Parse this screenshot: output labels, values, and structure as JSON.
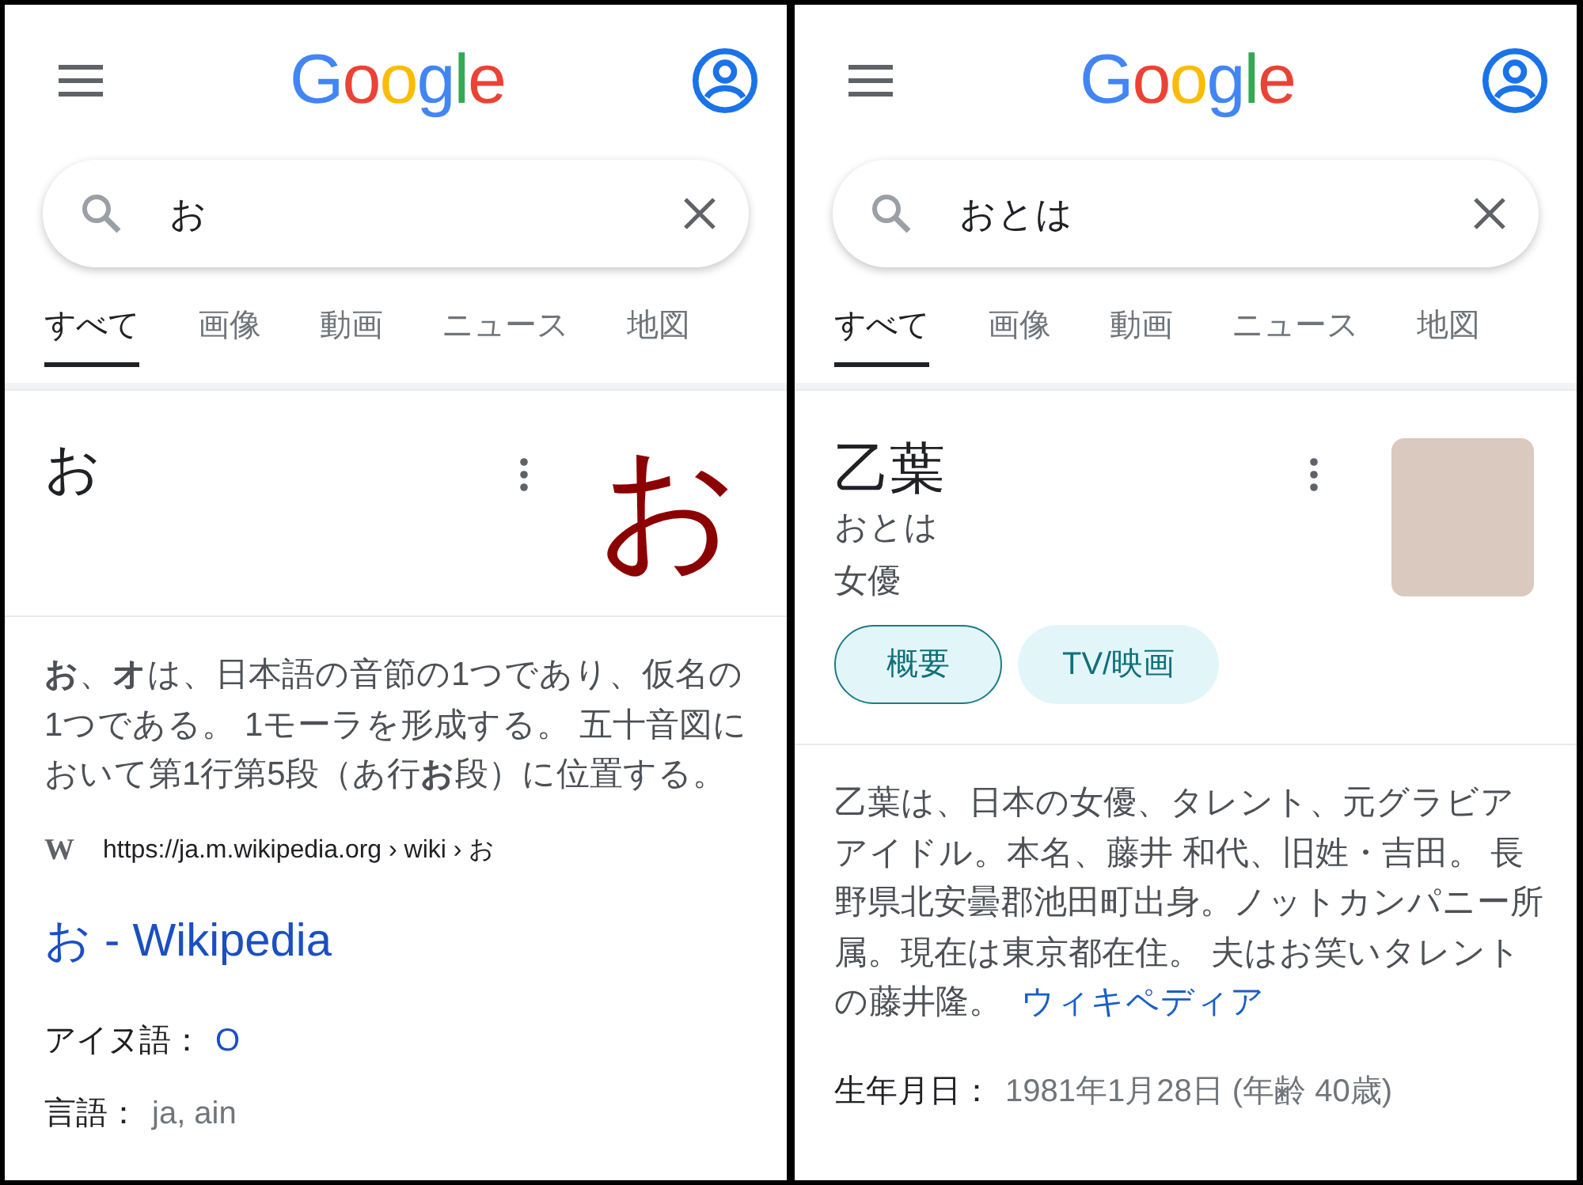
{
  "panels": [
    {
      "logo": "Google",
      "search": {
        "value": "お"
      },
      "tabs": [
        {
          "label": "すべて",
          "selected": true
        },
        {
          "label": "画像",
          "selected": false
        },
        {
          "label": "動画",
          "selected": false
        },
        {
          "label": "ニュース",
          "selected": false
        },
        {
          "label": "地図",
          "selected": false
        }
      ],
      "card": {
        "kind": "character",
        "title": "お",
        "glyph": "お",
        "description": "**お**、**オ**は、日本語の音節の1つであり、仮名の1つである。 1モーラを形成する。 五十音図において第1行第5段（あ行**お**段）に位置する。",
        "source": {
          "favicon": "W",
          "url": "https://ja.m.wikipedia.org › wiki › お"
        },
        "link_title": "お - Wikipedia",
        "facts": [
          {
            "label": "アイヌ語：",
            "value": "O",
            "link": true
          },
          {
            "label": "言語：",
            "value": "ja, ain",
            "link": false
          }
        ]
      }
    },
    {
      "logo": "Google",
      "search": {
        "value": "おとは"
      },
      "tabs": [
        {
          "label": "すべて",
          "selected": true
        },
        {
          "label": "画像",
          "selected": false
        },
        {
          "label": "動画",
          "selected": false
        },
        {
          "label": "ニュース",
          "selected": false
        },
        {
          "label": "地図",
          "selected": false
        }
      ],
      "card": {
        "kind": "person",
        "title": "乙葉",
        "subtitles": [
          "おとは",
          "女優"
        ],
        "chips": [
          {
            "label": "概要",
            "selected": true
          },
          {
            "label": "TV/映画",
            "selected": false
          }
        ],
        "description": "乙葉は、日本の女優、タレント、元グラビアアイドル。本名、藤井 和代、旧姓・吉田。 長野県北安曇郡池田町出身。ノットカンパニー所属。現在は東京都在住。 夫はお笑いタレントの藤井隆。",
        "description_link": "ウィキペディア",
        "facts": [
          {
            "label": "生年月日：",
            "value": "1981年1月28日 (年齢 40歳)",
            "link": false
          }
        ]
      }
    }
  ]
}
